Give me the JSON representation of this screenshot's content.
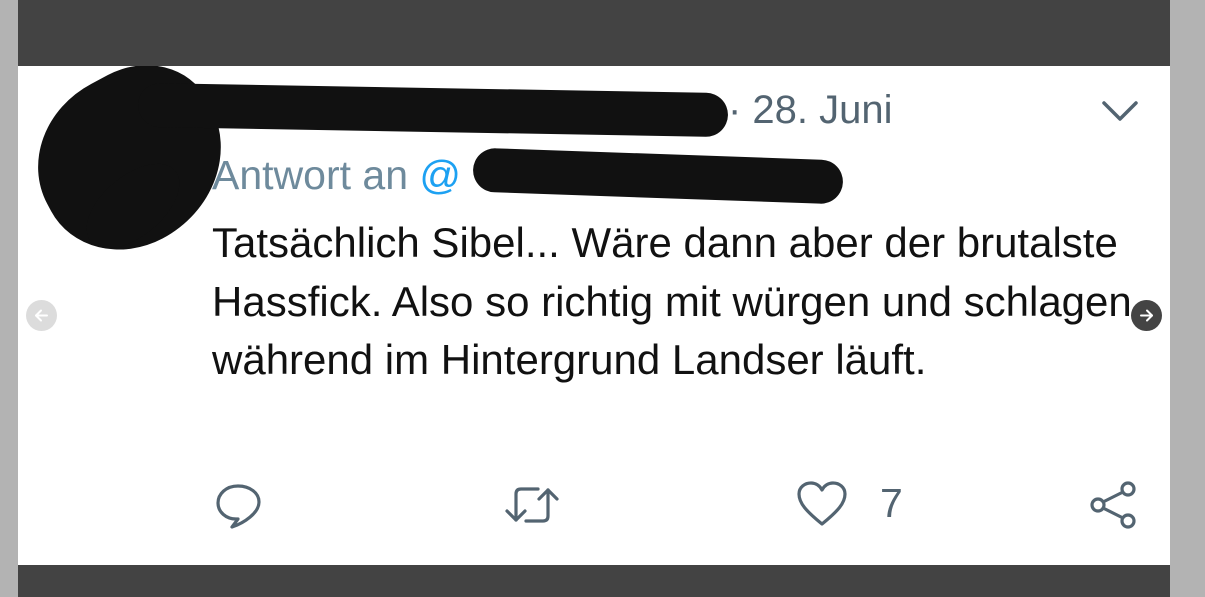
{
  "tweet": {
    "date": "· 28. Juni",
    "reply_prefix": "Antwort an ",
    "reply_at": "@",
    "text": "Tatsächlich Sibel... Wäre dann aber der brutalste Hassfick. Also so richtig mit würgen und schlagen während im Hintergrund Landser läuft.",
    "like_count": "7"
  },
  "icons": {
    "menu": "chevron-down-icon",
    "reply": "reply-icon",
    "retweet": "retweet-icon",
    "like": "heart-icon",
    "share": "share-icon",
    "prev": "arrow-left-icon",
    "next": "arrow-right-icon"
  },
  "colors": {
    "text": "#111111",
    "muted": "#536471",
    "accent": "#1da1f2",
    "chrome": "#434343"
  }
}
